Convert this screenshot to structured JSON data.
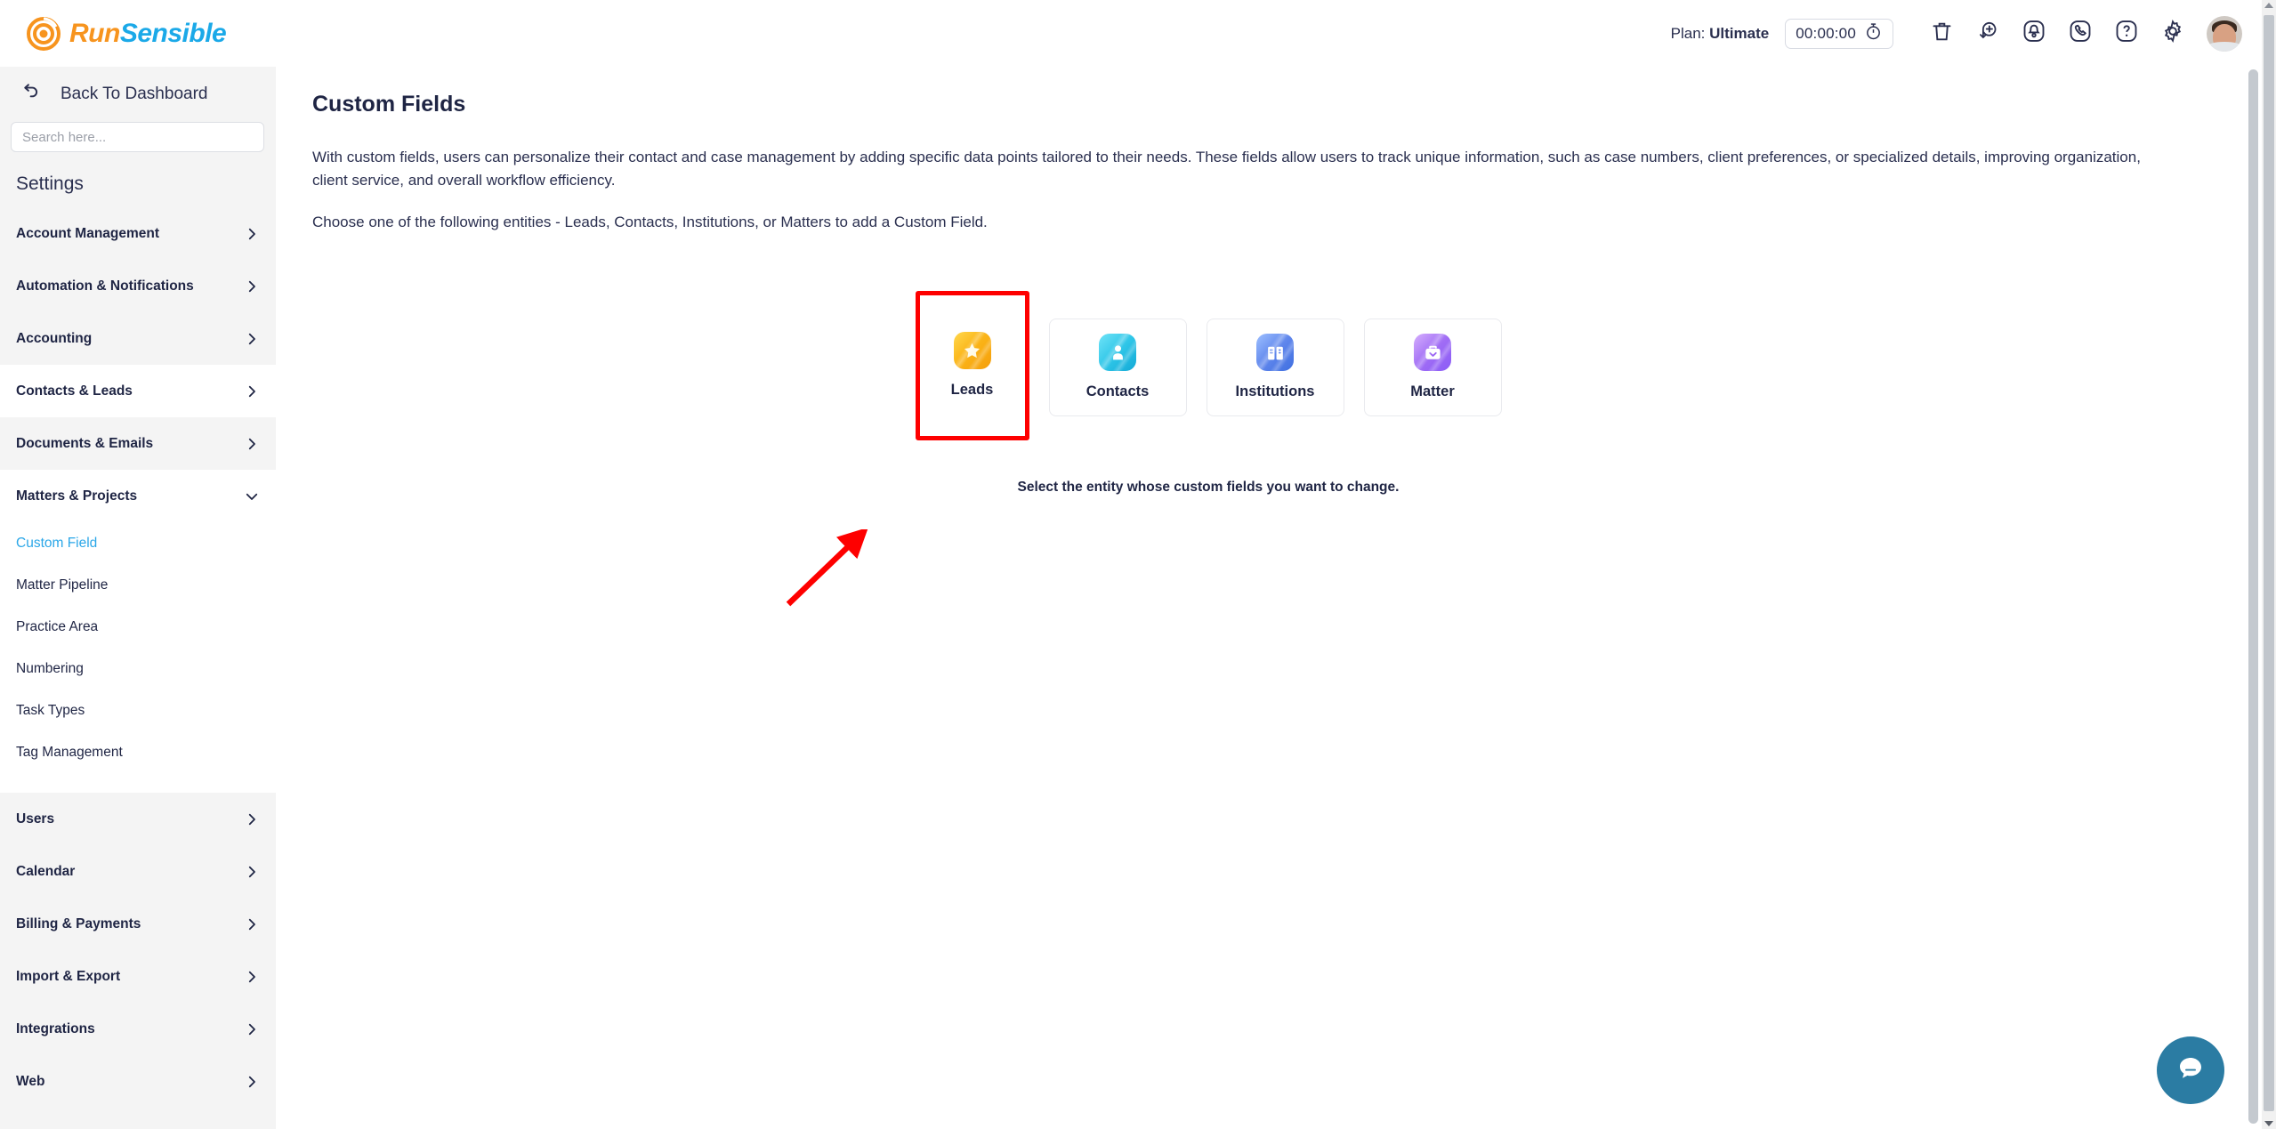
{
  "brand": {
    "name_part1": "Run",
    "name_part2": "Sensible",
    "orange": "#f7941e",
    "blue": "#1ba9e8"
  },
  "topbar": {
    "plan_prefix": "Plan: ",
    "plan_name": "Ultimate",
    "timer_value": "00:00:00",
    "icons": [
      {
        "name": "stopwatch-icon"
      },
      {
        "name": "trash-icon"
      },
      {
        "name": "add-task-icon"
      },
      {
        "name": "notification-bell-icon"
      },
      {
        "name": "phone-icon"
      },
      {
        "name": "help-question-icon"
      },
      {
        "name": "gear-icon"
      }
    ],
    "avatar_alt": "User avatar"
  },
  "sidebar": {
    "back_label": "Back To Dashboard",
    "search_placeholder": "Search here...",
    "search_value": "",
    "section_title": "Settings",
    "items": [
      {
        "label": "Account Management",
        "expanded": false,
        "active": false
      },
      {
        "label": "Automation & Notifications",
        "expanded": false,
        "active": false
      },
      {
        "label": "Accounting",
        "expanded": false,
        "active": false
      },
      {
        "label": "Contacts & Leads",
        "expanded": false,
        "active": true
      },
      {
        "label": "Documents & Emails",
        "expanded": false,
        "active": false
      },
      {
        "label": "Matters & Projects",
        "expanded": true,
        "active": false
      },
      {
        "label": "Users",
        "expanded": false,
        "active": false
      },
      {
        "label": "Calendar",
        "expanded": false,
        "active": false
      },
      {
        "label": "Billing & Payments",
        "expanded": false,
        "active": false
      },
      {
        "label": "Import & Export",
        "expanded": false,
        "active": false
      },
      {
        "label": "Integrations",
        "expanded": false,
        "active": false
      },
      {
        "label": "Web",
        "expanded": false,
        "active": false
      }
    ],
    "matters_submenu": [
      {
        "label": "Custom Field",
        "active": true
      },
      {
        "label": "Matter Pipeline",
        "active": false
      },
      {
        "label": "Practice Area",
        "active": false
      },
      {
        "label": "Numbering",
        "active": false
      },
      {
        "label": "Task Types",
        "active": false
      },
      {
        "label": "Tag Management",
        "active": false
      }
    ],
    "active_link_color": "#2ba7e8"
  },
  "main": {
    "title": "Custom Fields",
    "paragraph1": "With custom fields, users can personalize their contact and case management by adding specific data points tailored to their needs. These fields allow users to track unique information, such as case numbers, client preferences, or specialized details, improving organization, client service, and overall workflow efficiency.",
    "paragraph2": "Choose one of the following entities - Leads, Contacts, Institutions, or Matters to add a Custom Field.",
    "helper_text": "Select the entity whose custom fields you want to change.",
    "entities": [
      {
        "label": "Leads",
        "icon": "star-icon",
        "color_from": "#ffd84d",
        "color_to": "#f59e0b",
        "highlighted": true
      },
      {
        "label": "Contacts",
        "icon": "person-icon",
        "color_from": "#5ddcf5",
        "color_to": "#1fb6dd",
        "highlighted": false
      },
      {
        "label": "Institutions",
        "icon": "buildings-icon",
        "color_from": "#8ab4ff",
        "color_to": "#3f6fe0",
        "highlighted": false
      },
      {
        "label": "Matter",
        "icon": "briefcase-icon",
        "color_from": "#c79bfa",
        "color_to": "#8b5cf6",
        "highlighted": false
      }
    ],
    "highlight_color": "#fe0000"
  },
  "annotation": {
    "arrow_color": "#fe0000",
    "type": "arrow-pointing-up-right"
  },
  "chat": {
    "icon": "chat-bubble-icon",
    "bg_color": "#2b7ca3"
  }
}
